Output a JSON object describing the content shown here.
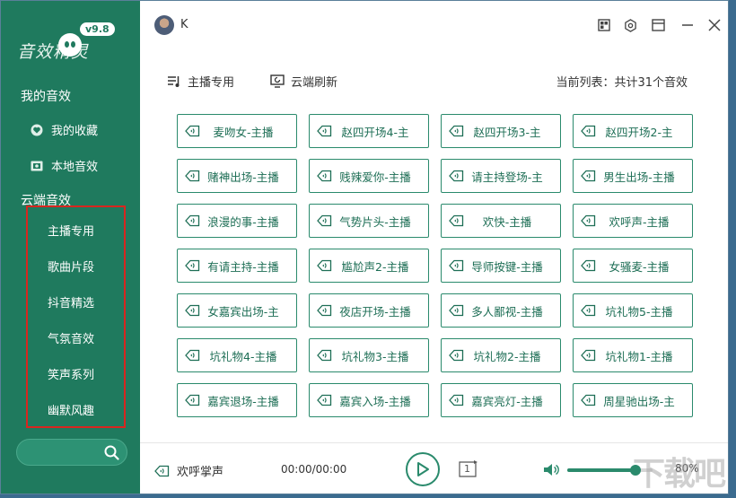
{
  "app": {
    "logo_text": "音效精灵",
    "version": "v9.8",
    "accent": "#2a8a6c",
    "sidebar_bg": "#1f7a5e"
  },
  "sidebar": {
    "my_sounds_title": "我的音效",
    "my_items": [
      {
        "label": "我的收藏",
        "icon": "heart-icon"
      },
      {
        "label": "本地音效",
        "icon": "local-folder-icon"
      }
    ],
    "cloud_title": "云端音效",
    "cloud_items": [
      "主播专用",
      "歌曲片段",
      "抖音精选",
      "气氛音效",
      "笑声系列",
      "幽默风趣"
    ],
    "search": {
      "value": "",
      "placeholder": ""
    }
  },
  "topbar": {
    "username": "K"
  },
  "toolbar": {
    "category_label": "主播专用",
    "refresh_label": "云端刷新",
    "count_text": "当前列表：共计31个音效"
  },
  "sounds": [
    "麦吻女-主播",
    "赵四开场4-主",
    "赵四开场3-主",
    "赵四开场2-主",
    "赌神出场-主播",
    "贱辣爱你-主播",
    "请主持登场-主",
    "男生出场-主播",
    "浪漫的事-主播",
    "气势片头-主播",
    "欢快-主播",
    "欢呼声-主播",
    "有请主持-主播",
    "尴尬声2-主播",
    "导师按键-主播",
    "女骚麦-主播",
    "女嘉宾出场-主",
    "夜店开场-主播",
    "多人鄙视-主播",
    "坑礼物5-主播",
    "坑礼物4-主播",
    "坑礼物3-主播",
    "坑礼物2-主播",
    "坑礼物1-主播",
    "嘉宾退场-主播",
    "嘉宾入场-主播",
    "嘉宾亮灯-主播",
    "周星驰出场-主"
  ],
  "player": {
    "now_playing": "欢呼掌声",
    "time": "00:00/00:00",
    "loop_count": "1",
    "volume_percent": 80,
    "volume_text": "80%"
  },
  "watermark": "下载吧"
}
